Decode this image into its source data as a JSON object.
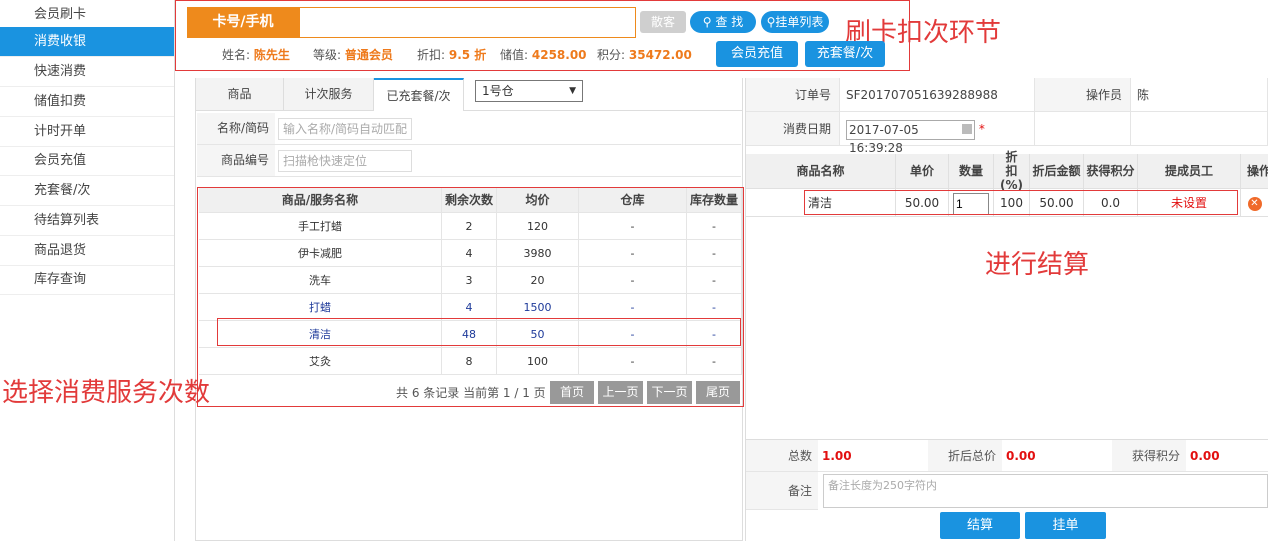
{
  "sidebar": {
    "items": [
      {
        "label": "会员刷卡",
        "active": false
      },
      {
        "label": "消费收银",
        "active": true
      },
      {
        "label": "快速消费",
        "active": false
      },
      {
        "label": "储值扣费",
        "active": false
      },
      {
        "label": "计时开单",
        "active": false
      },
      {
        "label": "会员充值",
        "active": false
      },
      {
        "label": "充套餐/次",
        "active": false
      },
      {
        "label": "待结算列表",
        "active": false
      },
      {
        "label": "商品退货",
        "active": false
      },
      {
        "label": "库存查询",
        "active": false
      }
    ]
  },
  "card_bar": {
    "label": "卡号/手机",
    "input_value": "",
    "guest_button": "散客",
    "search_button": "查 找",
    "hold_list_button": "挂单列表",
    "recharge_button": "会员充值",
    "package_button": "充套餐/次"
  },
  "member": {
    "name_label": "姓名:",
    "name": "陈先生",
    "level_label": "等级:",
    "level": "普通会员",
    "discount_label": "折扣:",
    "discount": "9.5 折",
    "balance_label": "储值:",
    "balance": "4258.00",
    "points_label": "积分:",
    "points": "35472.00"
  },
  "annotations": {
    "card_step": "刷卡扣次环节",
    "settle_step": "进行结算",
    "select_step": "选择消费服务次数"
  },
  "tabs": [
    {
      "label": "商品",
      "active": false
    },
    {
      "label": "计次服务",
      "active": false
    },
    {
      "label": "已充套餐/次",
      "active": true
    }
  ],
  "warehouse_select": {
    "value": "1号仓"
  },
  "search_form": {
    "name_label": "名称/简码",
    "name_placeholder": "输入名称/简码自动匹配",
    "code_label": "商品编号",
    "code_placeholder": "扫描枪快速定位"
  },
  "product_table": {
    "headers": [
      "商品/服务名称",
      "剩余次数",
      "均价",
      "仓库",
      "库存数量"
    ],
    "rows": [
      {
        "name": "手工打蜡",
        "remaining": "2",
        "price": "120",
        "warehouse": "-",
        "stock": "-",
        "highlight": false
      },
      {
        "name": "伊卡减肥",
        "remaining": "4",
        "price": "3980",
        "warehouse": "-",
        "stock": "-",
        "highlight": false
      },
      {
        "name": "洗车",
        "remaining": "3",
        "price": "20",
        "warehouse": "-",
        "stock": "-",
        "highlight": false
      },
      {
        "name": "打蜡",
        "remaining": "4",
        "price": "1500",
        "warehouse": "-",
        "stock": "-",
        "highlight": true
      },
      {
        "name": "清洁",
        "remaining": "48",
        "price": "50",
        "warehouse": "-",
        "stock": "-",
        "highlight": true
      },
      {
        "name": "艾灸",
        "remaining": "8",
        "price": "100",
        "warehouse": "-",
        "stock": "-",
        "highlight": false
      }
    ]
  },
  "pager": {
    "summary": "共 6 条记录 当前第 1 / 1 页",
    "first": "首页",
    "prev": "上一页",
    "next": "下一页",
    "last": "尾页"
  },
  "order": {
    "order_no_label": "订单号",
    "order_no": "SF201707051639288988",
    "operator_label": "操作员",
    "operator": "陈",
    "date_label": "消费日期",
    "date": "2017-07-05 16:39:28",
    "required_mark": "*"
  },
  "order_table": {
    "headers": [
      "商品名称",
      "单价",
      "数量",
      "折扣(%)",
      "折后金额",
      "获得积分",
      "提成员工",
      "操作"
    ],
    "rows": [
      {
        "name": "清洁",
        "price": "50.00",
        "qty": "1",
        "discount": "100",
        "amount": "50.00",
        "points": "0.0",
        "staff": "未设置"
      }
    ]
  },
  "summary": {
    "total_label": "总数",
    "total": "1.00",
    "discounted_label": "折后总价",
    "discounted": "0.00",
    "points_label": "获得积分",
    "points": "0.00",
    "remark_label": "备注",
    "remark_placeholder": "备注长度为250字符内"
  },
  "actions": {
    "settle": "结算",
    "hold": "挂单"
  },
  "colors": {
    "accent": "#1a93e0",
    "orange": "#ee8a1c",
    "annotation": "#e23a3a"
  }
}
